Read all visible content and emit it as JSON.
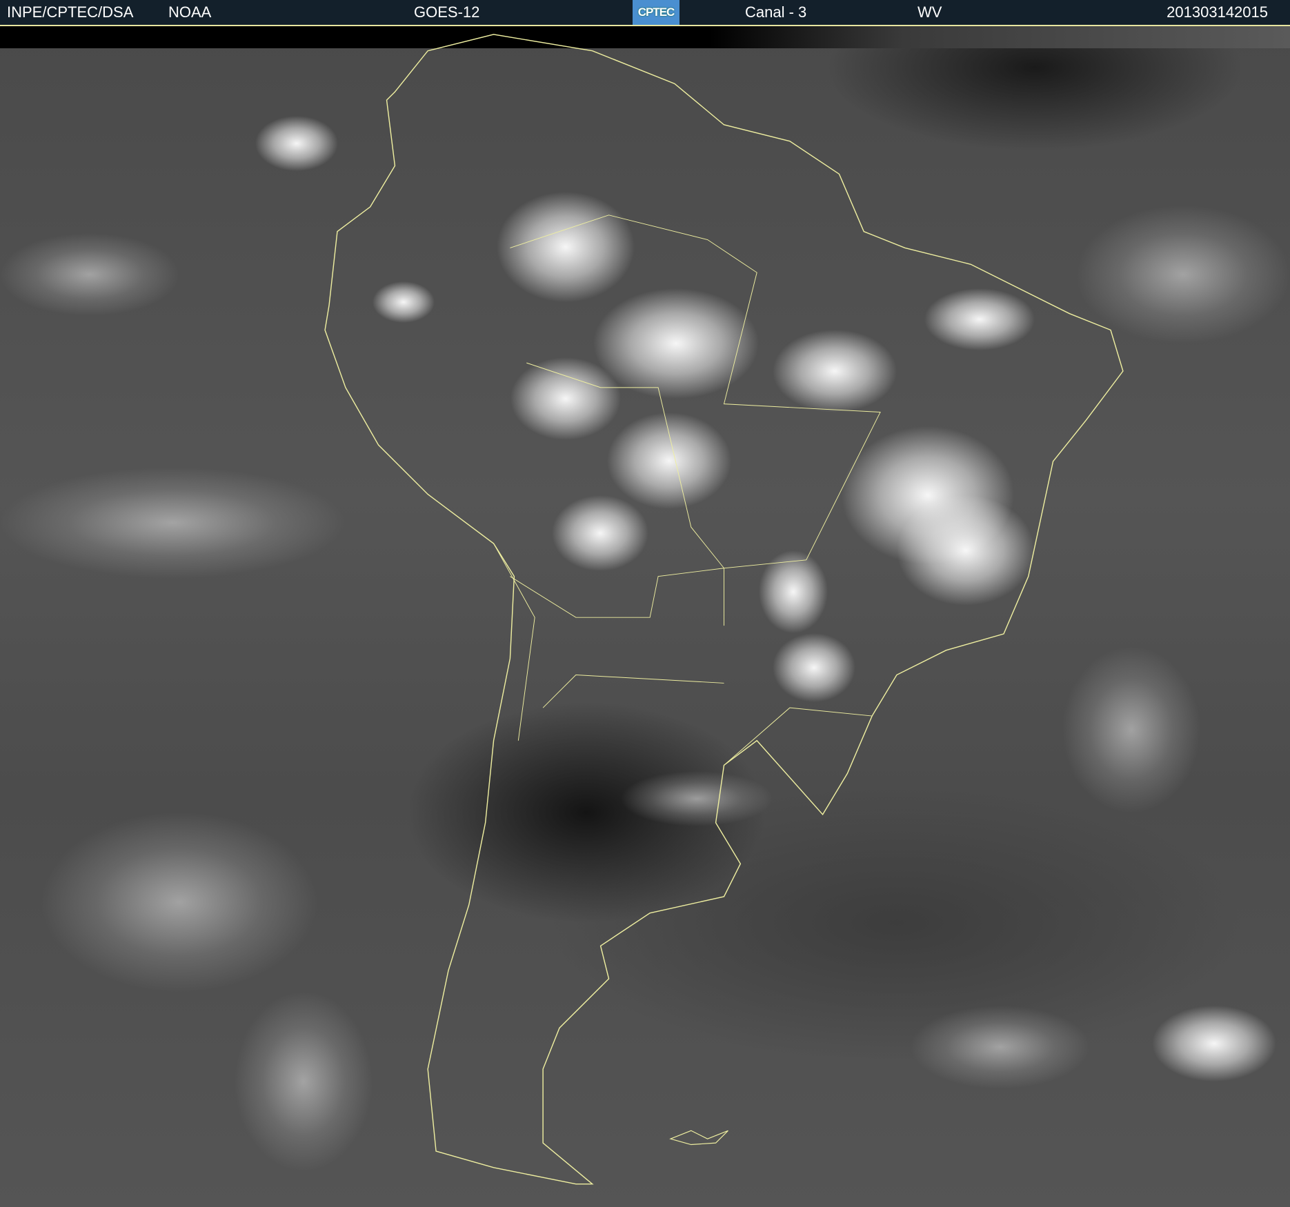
{
  "header": {
    "agency": "INPE/CPTEC/DSA",
    "source": "NOAA",
    "satellite": "GOES-12",
    "logo_text": "CPTEC",
    "channel": "Canal - 3",
    "band": "WV",
    "timestamp": "201303142015"
  },
  "colors": {
    "header_bg": "#13202b",
    "border": "#e8e6a0",
    "logo_bg": "#4a8fd0"
  }
}
